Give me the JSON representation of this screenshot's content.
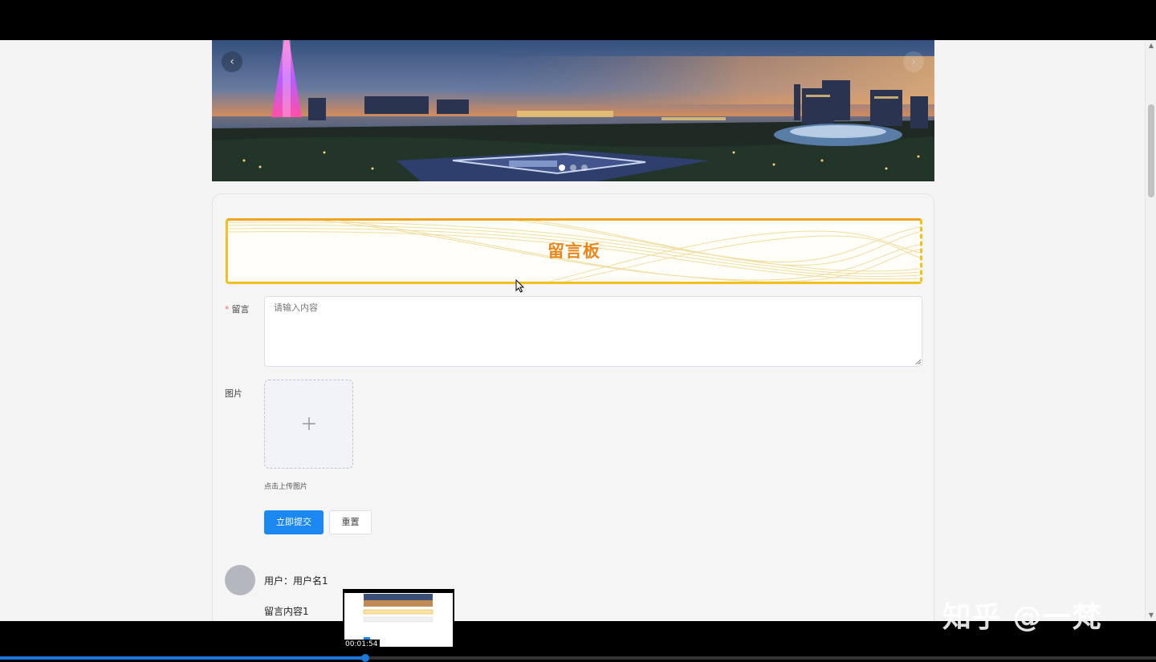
{
  "carousel": {
    "prev_icon": "‹",
    "next_icon": "›",
    "slide_count": 3,
    "active_slide": 1
  },
  "board": {
    "title": "留言板"
  },
  "form": {
    "message_label": "留言",
    "required_mark": "*",
    "message_placeholder": "请输入内容",
    "image_label": "图片",
    "upload_hint": "点击上传图片",
    "submit_label": "立即提交",
    "reset_label": "重置"
  },
  "comment": {
    "user": "用户：用户名1",
    "content": "留言内容1"
  },
  "player": {
    "preview_time": "00:01:54",
    "progress": 0.316
  },
  "watermark": "知乎 @一梵",
  "colors": {
    "accent": "#1a88f0",
    "banner_border": "#f2c11e",
    "banner_title": "#e8861a",
    "required": "#f56c6c"
  }
}
